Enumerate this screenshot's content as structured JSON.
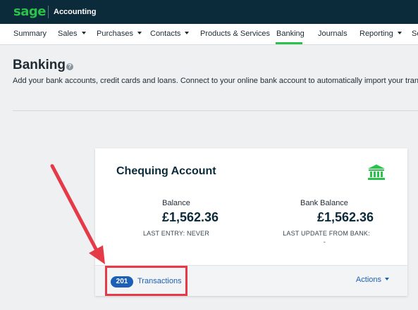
{
  "header": {
    "logo_text": "sage",
    "app_name": "Accounting"
  },
  "nav": {
    "items": [
      {
        "label": "Summary",
        "has_dropdown": false
      },
      {
        "label": "Sales",
        "has_dropdown": true
      },
      {
        "label": "Purchases",
        "has_dropdown": true
      },
      {
        "label": "Contacts",
        "has_dropdown": true
      },
      {
        "label": "Products & Services",
        "has_dropdown": false
      },
      {
        "label": "Banking",
        "has_dropdown": false,
        "active": true
      },
      {
        "label": "Journals",
        "has_dropdown": false
      },
      {
        "label": "Reporting",
        "has_dropdown": true
      },
      {
        "label": "Se",
        "has_dropdown": false
      }
    ]
  },
  "page": {
    "title": "Banking",
    "help_icon": "question-icon",
    "description": "Add your bank accounts, credit cards and loans. Connect to your online bank account to automatically import your transactions"
  },
  "account_card": {
    "name": "Chequing Account",
    "icon": "bank-icon",
    "balance_label": "Balance",
    "balance_value": "£1,562.36",
    "balance_sub": "LAST ENTRY: NEVER",
    "bank_balance_label": "Bank Balance",
    "bank_balance_value": "£1,562.36",
    "bank_balance_sub": "LAST UPDATE FROM BANK:",
    "bank_balance_sub_value": "-",
    "transactions_count": "201",
    "transactions_label": "Transactions",
    "actions_label": "Actions"
  },
  "colors": {
    "topbar": "#0b2a3a",
    "brand_green": "#2ac24a",
    "link_blue": "#1b5fb8",
    "annotation_red": "#e53a48"
  }
}
